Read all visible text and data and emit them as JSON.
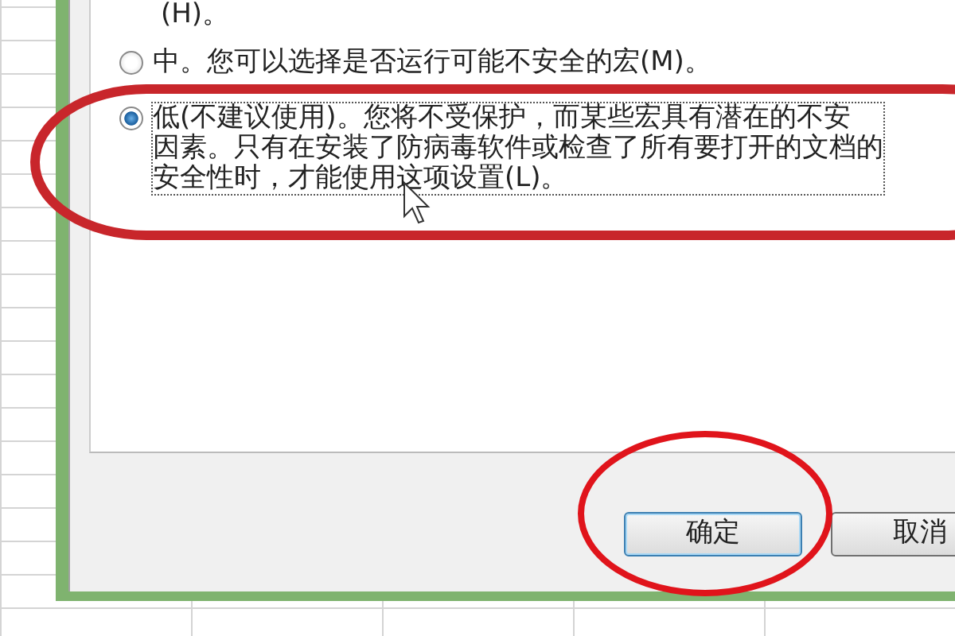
{
  "dialog": {
    "top_fragment": "(H)。",
    "options": [
      {
        "lines": [
          "中。您可以选择是否运行可能不安全的宏(M)。"
        ],
        "selected": false
      },
      {
        "lines": [
          "低(不建议使用)。您将不受保护，而某些宏具有潜在的不安",
          "因素。只有在安装了防病毒软件或检查了所有要打开的文档的",
          "安全性时，才能使用这项设置(L)。"
        ],
        "selected": true
      }
    ],
    "buttons": [
      {
        "label": "确定",
        "kind": "default"
      },
      {
        "label": "取消",
        "kind": "normal"
      }
    ]
  }
}
